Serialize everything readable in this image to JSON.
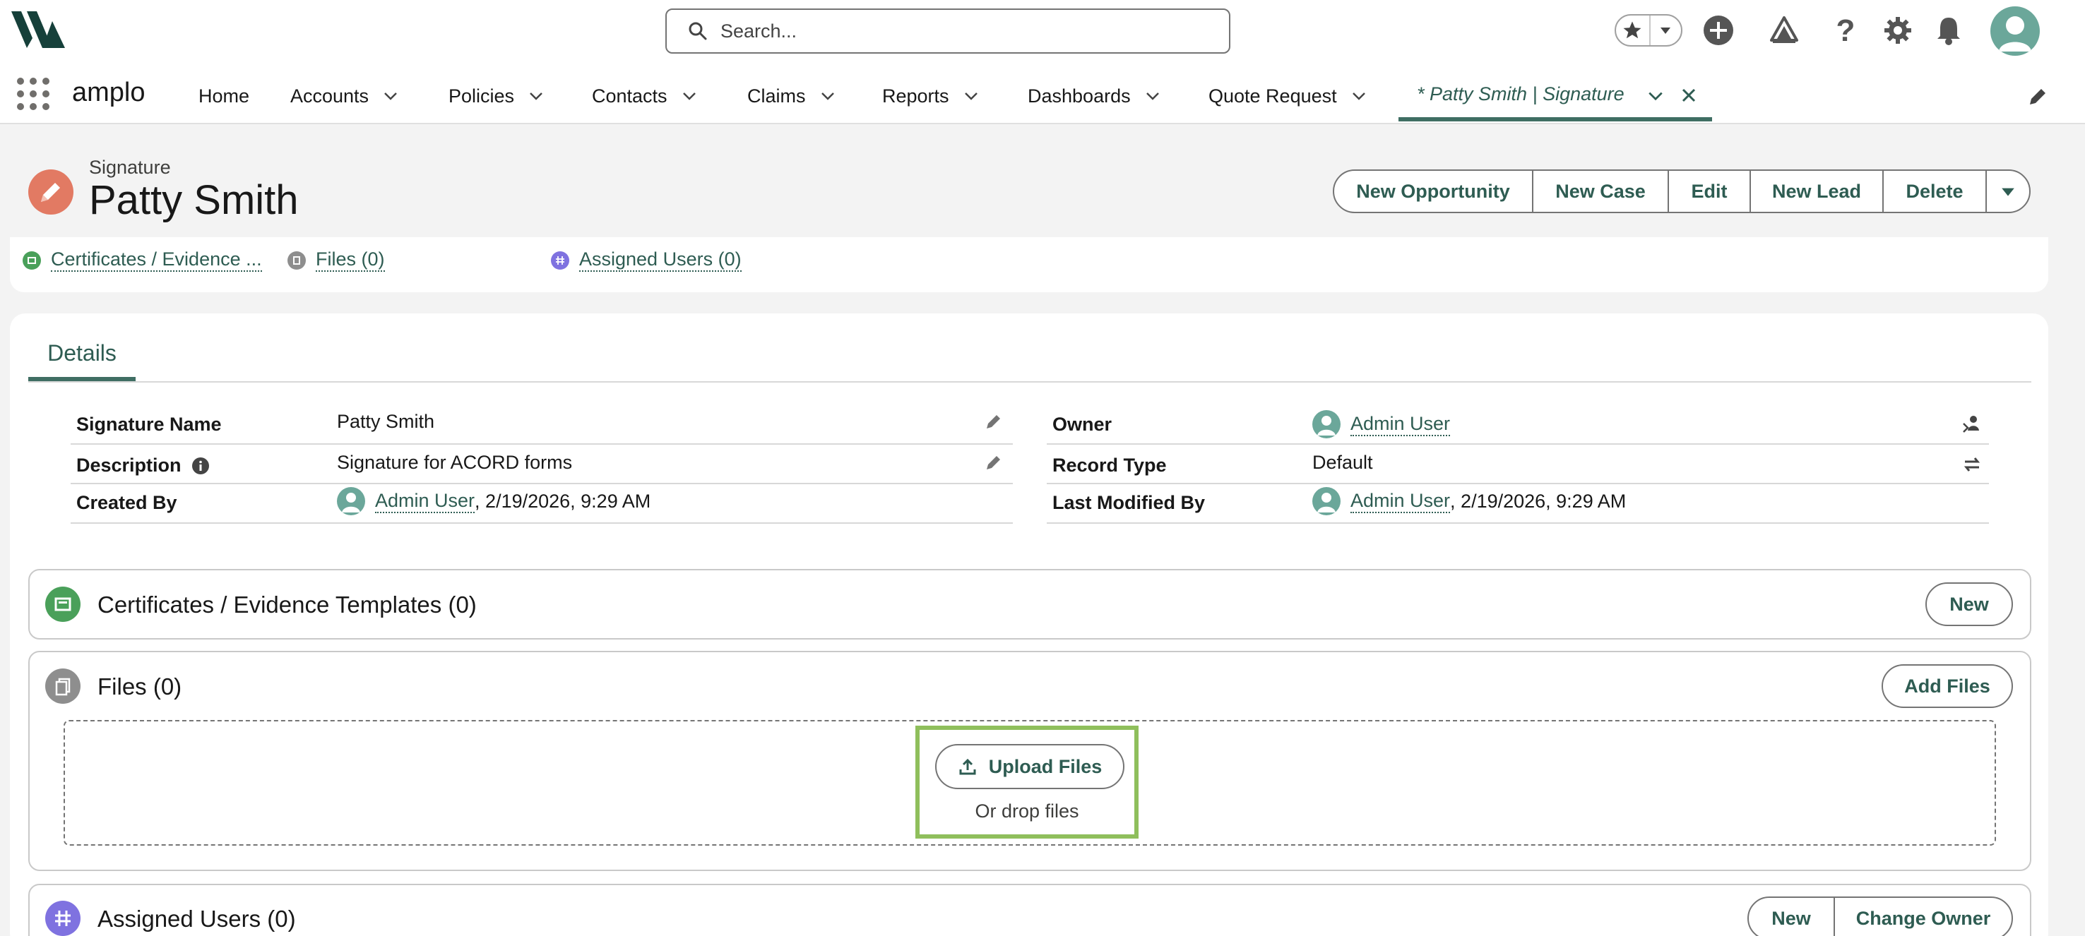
{
  "header": {
    "search_placeholder": "Search...",
    "icons": [
      "favorites-star-icon",
      "add-icon",
      "trailhead-icon",
      "help-icon",
      "setup-gear-icon",
      "notification-bell-icon",
      "user-avatar"
    ]
  },
  "nav": {
    "app_name": "amplo",
    "items": [
      {
        "label": "Home",
        "has_menu": false
      },
      {
        "label": "Accounts",
        "has_menu": true
      },
      {
        "label": "Policies",
        "has_menu": true
      },
      {
        "label": "Contacts",
        "has_menu": true
      },
      {
        "label": "Claims",
        "has_menu": true
      },
      {
        "label": "Reports",
        "has_menu": true
      },
      {
        "label": "Dashboards",
        "has_menu": true
      },
      {
        "label": "Quote Request",
        "has_menu": true
      }
    ],
    "active_tab": "* Patty Smith | Signature"
  },
  "record": {
    "object_label": "Signature",
    "title": "Patty Smith",
    "actions": [
      "New Opportunity",
      "New Case",
      "Edit",
      "New Lead",
      "Delete"
    ]
  },
  "highlights": {
    "links": [
      "Certificates / Evidence ...",
      "Files (0)",
      "Assigned Users (0)"
    ]
  },
  "details": {
    "tab_label": "Details",
    "left": [
      {
        "label": "Signature Name",
        "value": "Patty Smith"
      },
      {
        "label": "Description",
        "value": "Signature for ACORD forms"
      },
      {
        "label": "Created By",
        "user": "Admin User",
        "date": ", 2/19/2026, 9:29 AM"
      }
    ],
    "right": [
      {
        "label": "Owner",
        "user": "Admin User"
      },
      {
        "label": "Record Type",
        "value": "Default"
      },
      {
        "label": "Last Modified By",
        "user": "Admin User",
        "date": ", 2/19/2026, 9:29 AM"
      }
    ]
  },
  "related": {
    "certificates": {
      "title": "Certificates / Evidence Templates (0)",
      "button": "New"
    },
    "files": {
      "title": "Files (0)",
      "button": "Add Files",
      "upload_label": "Upload Files",
      "drop_label": "Or drop files"
    },
    "assigned_users": {
      "title": "Assigned Users (0)",
      "buttons": [
        "New",
        "Change Owner"
      ]
    }
  },
  "colors": {
    "brand": "#2e5c52",
    "accent_bar": "#3f6e63",
    "record_icon": "#e27a63",
    "certificates_icon": "#4aa05a",
    "files_icon": "#8e8e8e",
    "assigned_icon": "#7f72e0",
    "highlight_box": "#8fbf5c"
  }
}
